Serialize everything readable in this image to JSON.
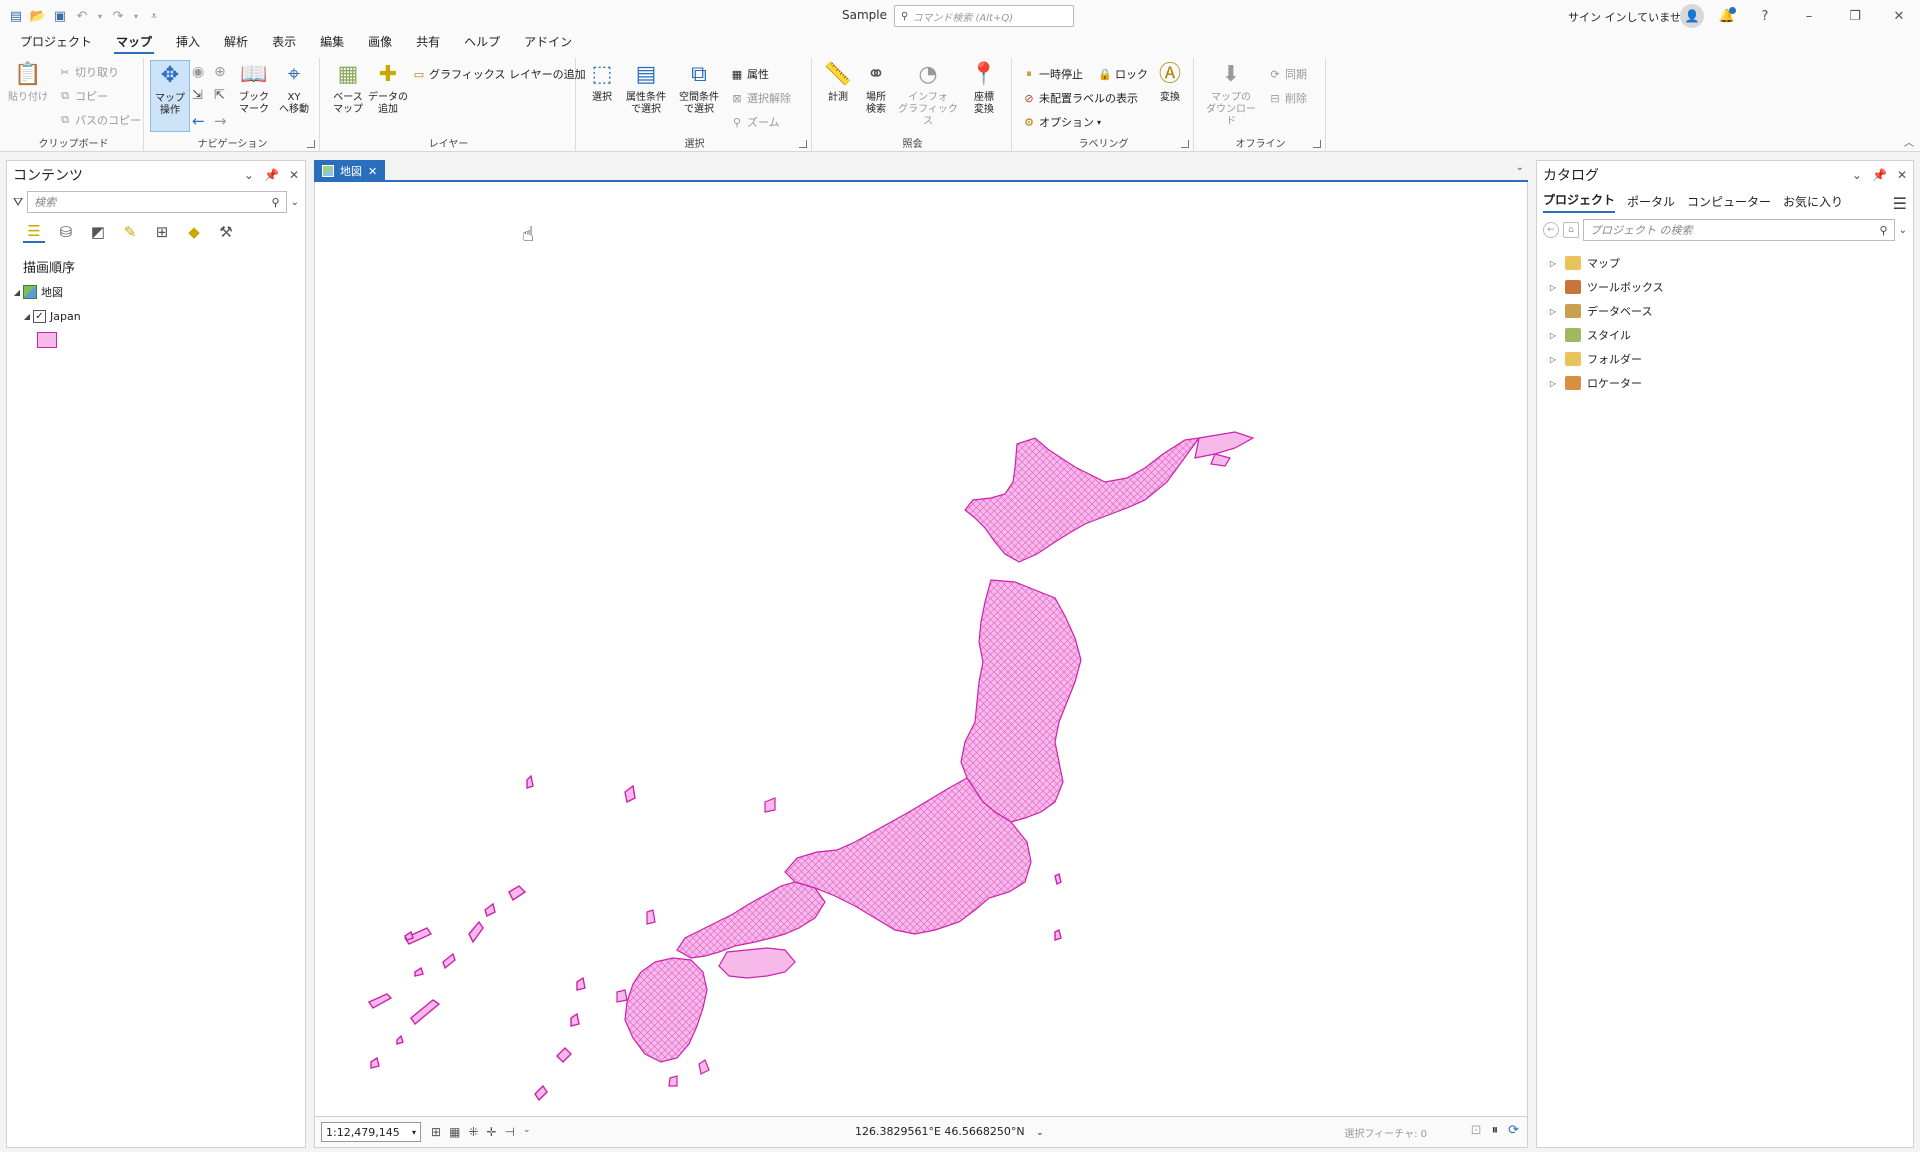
{
  "window": {
    "doc_title": "Sample",
    "command_search_placeholder": "コマンド検索 (Alt+Q)",
    "signin_text": "サイン インしていません",
    "help_icon": "?",
    "qat_icons": [
      "new-project-icon",
      "open-icon",
      "save-icon",
      "undo-icon",
      "redo-icon",
      "customize-icon"
    ]
  },
  "ribbon_tabs": [
    "プロジェクト",
    "マップ",
    "挿入",
    "解析",
    "表示",
    "編集",
    "画像",
    "共有",
    "ヘルプ",
    "アドイン"
  ],
  "ribbon_active_tab": "マップ",
  "ribbon": {
    "clipboard": {
      "label": "クリップボード",
      "paste": "貼り付け",
      "cut": "切り取り",
      "copy": "コピー",
      "copy_path": "パスのコピー"
    },
    "navigation": {
      "label": "ナビゲーション",
      "explore": "マップ\n操作",
      "bookmark": "ブック\nマーク",
      "goto_xy": "XY\nへ移動"
    },
    "layer": {
      "label": "レイヤー",
      "basemap": "ベース\nマップ",
      "add_data": "データの\n追加",
      "add_graphics_layer": "グラフィックス レイヤーの追加"
    },
    "selection": {
      "label": "選択",
      "select": "選択",
      "select_by_attr": "属性条件\nで選択",
      "select_by_loc": "空間条件\nで選択",
      "attributes": "属性",
      "clear": "選択解除",
      "zoom": "ズーム"
    },
    "inquiry": {
      "label": "照会",
      "measure": "計測",
      "locate": "場所\n検索",
      "infographics": "インフォ\nグラフィックス",
      "coord_conv": "座標\n変換"
    },
    "labeling": {
      "label": "ラベリング",
      "pause": "一時停止",
      "lock": "ロック",
      "unplaced": "未配置ラベルの表示",
      "options": "オプション",
      "convert": "変換"
    },
    "offline": {
      "label": "オフライン",
      "download_map": "マップの\nダウンロード",
      "sync": "同期",
      "remove": "削除"
    }
  },
  "contents": {
    "title": "コンテンツ",
    "search_placeholder": "検索",
    "section_title": "描画順序",
    "map_name": "地図",
    "layer_name": "Japan",
    "layer_color": "#f7b8ea",
    "layer_outline": "#cc22aa"
  },
  "map_view": {
    "tab_label": "地図",
    "scale": "1:12,479,145",
    "coordinates": "126.3829561°E 46.5668250°N",
    "selected_features": "選択フィーチャ: 0"
  },
  "catalog": {
    "title": "カタログ",
    "tabs": [
      "プロジェクト",
      "ポータル",
      "コンピューター",
      "お気に入り"
    ],
    "active_tab": "プロジェクト",
    "search_placeholder": "プロジェクト の検索",
    "items": [
      {
        "label": "マップ",
        "color": "#e8c45a"
      },
      {
        "label": "ツールボックス",
        "color": "#c9743a"
      },
      {
        "label": "データベース",
        "color": "#c8a050"
      },
      {
        "label": "スタイル",
        "color": "#a0b860"
      },
      {
        "label": "フォルダー",
        "color": "#e8c45a"
      },
      {
        "label": "ロケーター",
        "color": "#d89040"
      }
    ]
  }
}
